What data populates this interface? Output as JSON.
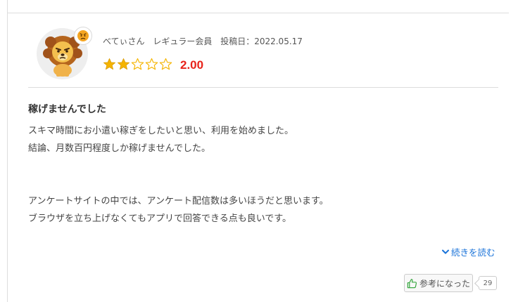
{
  "review": {
    "reviewer_name": "べてぃさん",
    "member_rank": "レギュラー会員",
    "date_label": "投稿日：2022.05.17",
    "rating": {
      "score": 2,
      "max": 5,
      "display": "2.00",
      "filled_color": "#f5b400",
      "empty_color": "#f5b400"
    },
    "title": "稼げませんでした",
    "body_lines": [
      "スキマ時間にお小遣い稼ぎをしたいと思い、利用を始めました。",
      "結論、月数百円程度しか稼げませんでした。",
      "",
      "",
      "アンケートサイトの中では、アンケート配信数は多いほうだと思います。",
      "ブラウザを立ち上げなくてもアプリで回答できる点も良いです。"
    ],
    "read_more_label": "続きを読む",
    "helpful_label": "参考になった",
    "helpful_count": "29"
  },
  "icons": {
    "avatar": "lion-avatar-icon",
    "mood": "angry-face-icon",
    "read_more": "chevron-down-icon",
    "helpful": "thumbs-up-icon"
  },
  "colors": {
    "accent_link": "#1a73d9",
    "rating_value": "#e8231a",
    "thumbs_up": "#3aa843"
  }
}
